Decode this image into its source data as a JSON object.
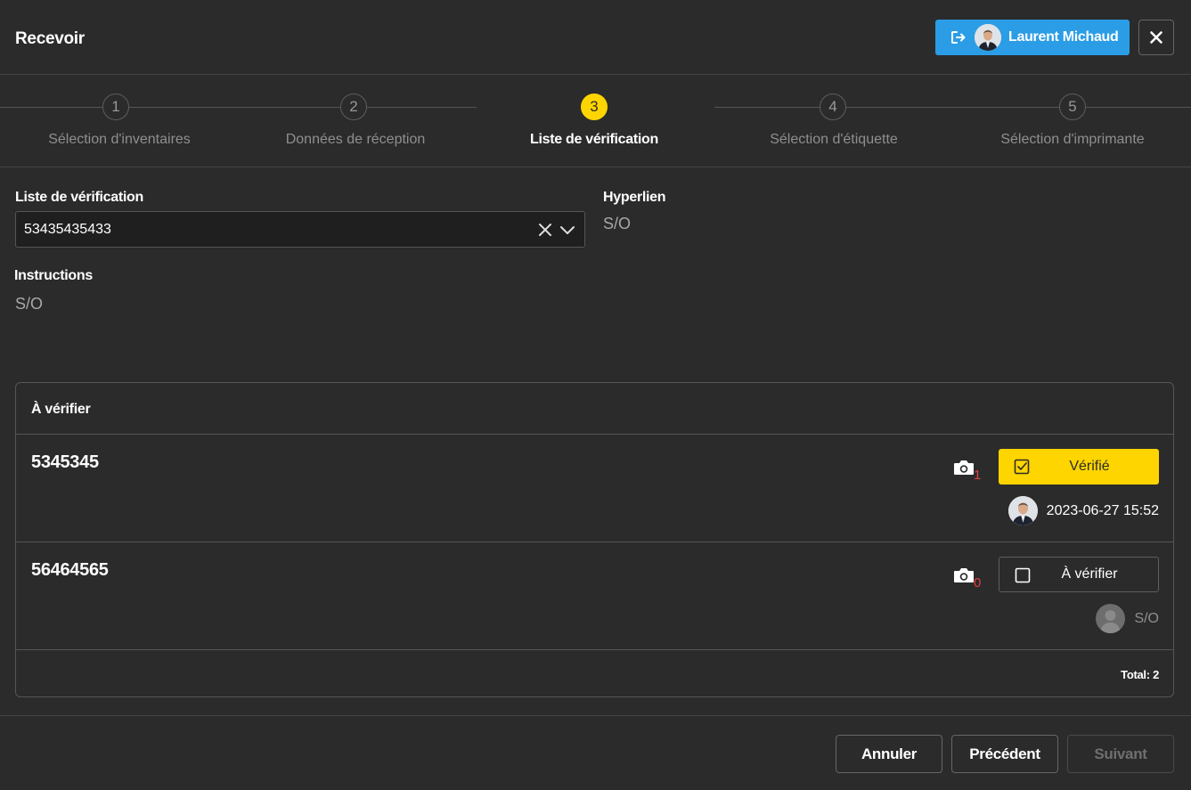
{
  "dialog": {
    "title": "Recevoir",
    "user_name": "Laurent Michaud",
    "icons": {
      "logout": "logout-icon",
      "close": "close-icon",
      "avatar": "user-avatar"
    }
  },
  "stepper": {
    "active_step": 3,
    "steps": [
      {
        "number": "1",
        "label": "Sélection d'inventaires"
      },
      {
        "number": "2",
        "label": "Données de réception"
      },
      {
        "number": "3",
        "label": "Liste de vérification"
      },
      {
        "number": "4",
        "label": "Sélection d'étiquette"
      },
      {
        "number": "5",
        "label": "Sélection d'imprimante"
      }
    ]
  },
  "form": {
    "checklist_label": "Liste de vérification",
    "checklist_value": "53435435433",
    "hyperlink_label": "Hyperlien",
    "hyperlink_value": "S/O",
    "instructions_label": "Instructions",
    "instructions_value": "S/O"
  },
  "verification": {
    "header": "À vérifier",
    "items": [
      {
        "code": "5345345",
        "photo_count": "1",
        "status_label": "Vérifié",
        "verified": true,
        "verified_at": "2023-06-27 15:52"
      },
      {
        "code": "56464565",
        "photo_count": "0",
        "status_label": "À vérifier",
        "verified": false,
        "verified_at": "S/O"
      }
    ],
    "total": "Total: 2"
  },
  "footer": {
    "cancel": "Annuler",
    "previous": "Précédent",
    "next": "Suivant"
  },
  "colors": {
    "background": "#2b2b2b",
    "accent_blue": "#2b9de6",
    "accent_yellow": "#ffd500",
    "photo_count": "#e04040"
  }
}
